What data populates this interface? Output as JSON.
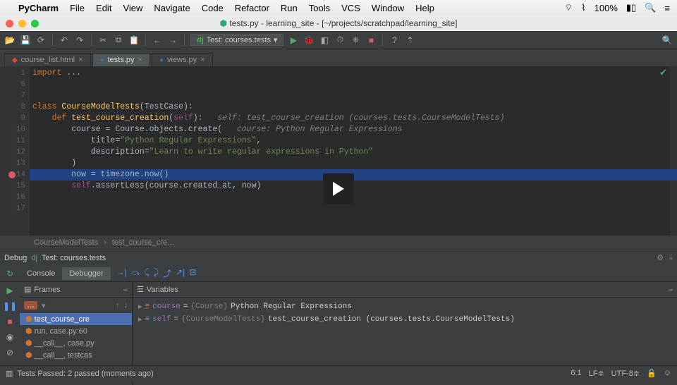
{
  "macos": {
    "app": "PyCharm",
    "menus": [
      "File",
      "Edit",
      "View",
      "Navigate",
      "Code",
      "Refactor",
      "Run",
      "Tools",
      "VCS",
      "Window",
      "Help"
    ],
    "battery": "100%"
  },
  "window": {
    "filename": "tests.py",
    "project": "learning_site",
    "path": "[~/projects/scratchpad/learning_site]"
  },
  "run_config": "Test: courses.tests",
  "tabs": [
    {
      "label": "course_list.html",
      "icon": "html"
    },
    {
      "label": "tests.py",
      "icon": "py",
      "active": true
    },
    {
      "label": "views.py",
      "icon": "py"
    }
  ],
  "editor": {
    "first_line": 1,
    "lines": [
      {
        "n": 1,
        "html": "<span class='k'>import</span> <span class='p'>...</span>"
      },
      {
        "n": 6,
        "html": ""
      },
      {
        "n": 7,
        "html": ""
      },
      {
        "n": 8,
        "html": "<span class='k'>class</span> <span class='fn'>CourseModelTests</span><span class='p'>(TestCase):</span>"
      },
      {
        "n": 9,
        "html": "    <span class='k'>def</span> <span class='fn'>test_course_creation</span><span class='p'>(</span><span class='self'>self</span><span class='p'>):</span>   <span class='c'>self: test_course_creation (courses.tests.CourseModelTests)</span>"
      },
      {
        "n": 10,
        "html": "        <span class='p'>course = Course.objects.create(</span>   <span class='c'>course: Python Regular Expressions</span>"
      },
      {
        "n": 11,
        "html": "            <span class='p'>title=</span><span class='s'>\"Python Regular Expressions\"</span><span class='p'>,</span>"
      },
      {
        "n": 12,
        "html": "            <span class='p'>description=</span><span class='s'>\"Learn to write regular expressions in Python\"</span>"
      },
      {
        "n": 13,
        "html": "        <span class='p'>)</span>"
      },
      {
        "n": 14,
        "html": "        <span class='p'>now</span> <span class='p'>=</span> <span class='p'>timezone.now()</span>",
        "hl": true,
        "bp": true
      },
      {
        "n": 15,
        "html": "        <span class='self'>self</span><span class='p'>.assertLess(course.created_at, now)</span>"
      },
      {
        "n": 16,
        "html": ""
      },
      {
        "n": 17,
        "html": ""
      }
    ],
    "breadcrumb": [
      "CourseModelTests",
      "test_course_cre…"
    ]
  },
  "debug": {
    "title": "Debug",
    "config": "Test: courses.tests",
    "tabs": [
      "Console",
      "Debugger"
    ],
    "active_tab": "Debugger",
    "frames_label": "Frames",
    "vars_label": "Variables",
    "thread": "…",
    "frames": [
      {
        "label": "test_course_cre",
        "sel": true
      },
      {
        "label": "run, case.py:60"
      },
      {
        "label": "__call__, case.py"
      },
      {
        "label": "__call__, testcas"
      }
    ],
    "vars": [
      {
        "name": "course",
        "type": "{Course}",
        "value": "Python Regular Expressions"
      },
      {
        "name": "self",
        "type": "{CourseModelTests}",
        "value": "test_course_creation (courses.tests.CourseModelTests)"
      }
    ]
  },
  "status": {
    "left": "Tests Passed: 2 passed (moments ago)",
    "pos": "6:1",
    "sep": "LF",
    "enc": "UTF-8"
  }
}
